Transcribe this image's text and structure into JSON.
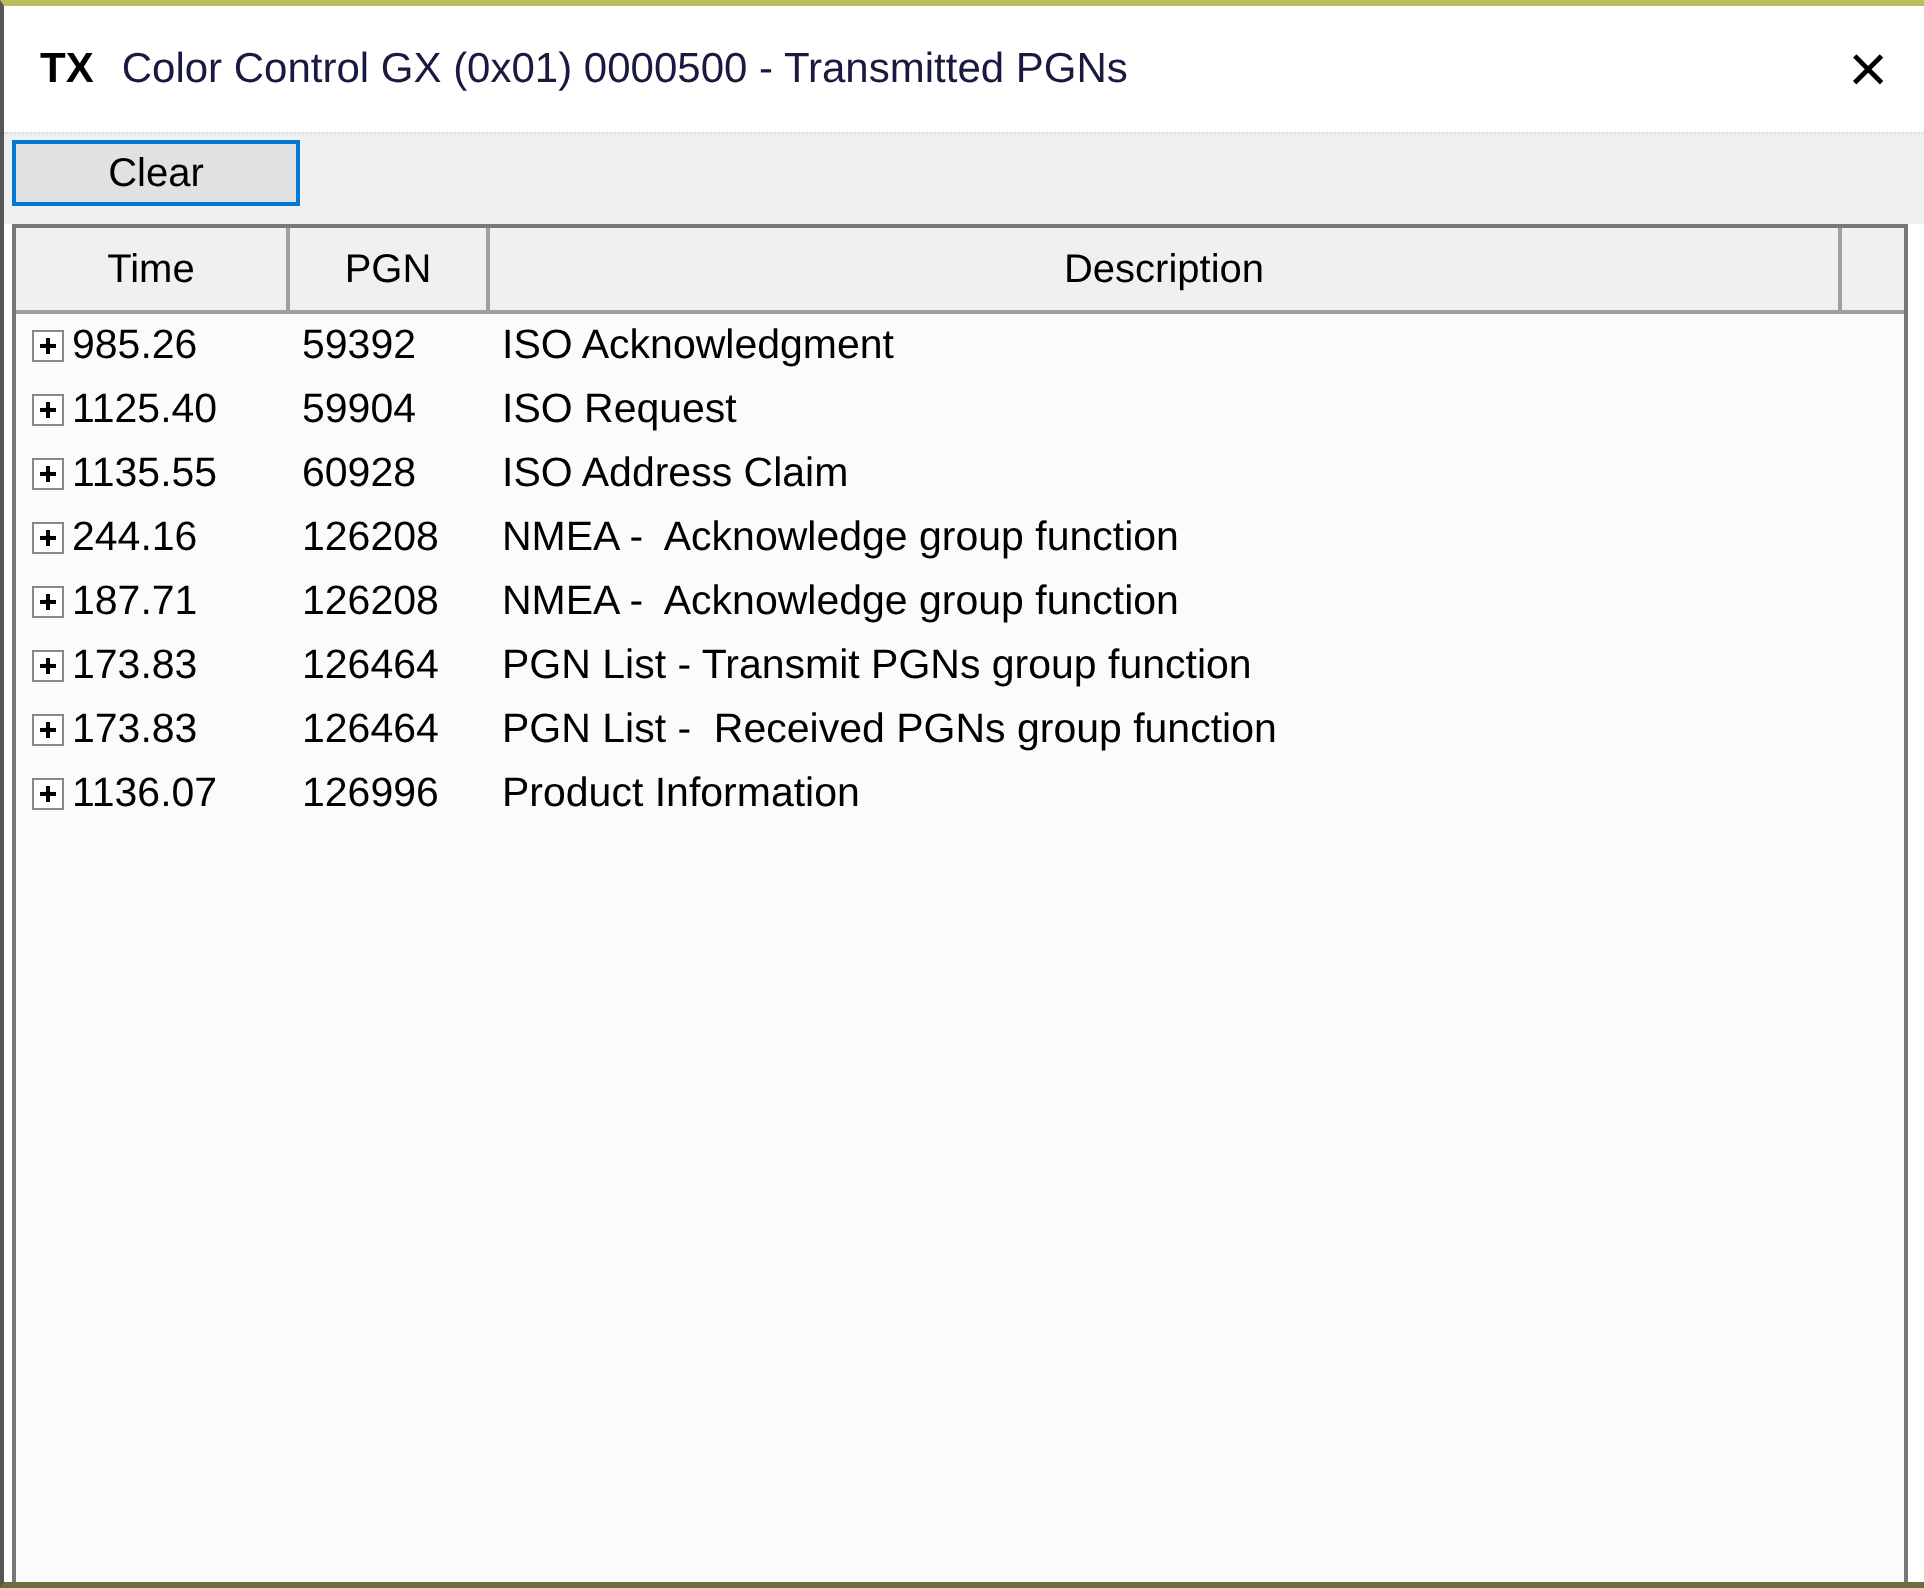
{
  "window": {
    "badge": "TX",
    "title": "Color Control GX (0x01) 0000500 - Transmitted PGNs",
    "close": "×"
  },
  "toolbar": {
    "buttons": [
      {
        "label": "Clear",
        "focused": true
      }
    ]
  },
  "table": {
    "columns": [
      "Time",
      "PGN",
      "Description"
    ],
    "rows": [
      {
        "time": "985.26",
        "pgn": "59392",
        "description": "ISO Acknowledgment",
        "expanded": false
      },
      {
        "time": "1125.40",
        "pgn": "59904",
        "description": "ISO Request",
        "expanded": false
      },
      {
        "time": "1135.55",
        "pgn": "60928",
        "description": "ISO Address Claim",
        "expanded": false
      },
      {
        "time": "244.16",
        "pgn": "126208",
        "description": "NMEA -  Acknowledge group function",
        "expanded": false
      },
      {
        "time": "187.71",
        "pgn": "126208",
        "description": "NMEA -  Acknowledge group function",
        "expanded": false
      },
      {
        "time": "173.83",
        "pgn": "126464",
        "description": "PGN List - Transmit PGNs group function",
        "expanded": false
      },
      {
        "time": "173.83",
        "pgn": "126464",
        "description": "PGN List -  Received PGNs group function",
        "expanded": false
      },
      {
        "time": "1136.07",
        "pgn": "126996",
        "description": "Product Information",
        "expanded": false
      }
    ]
  }
}
